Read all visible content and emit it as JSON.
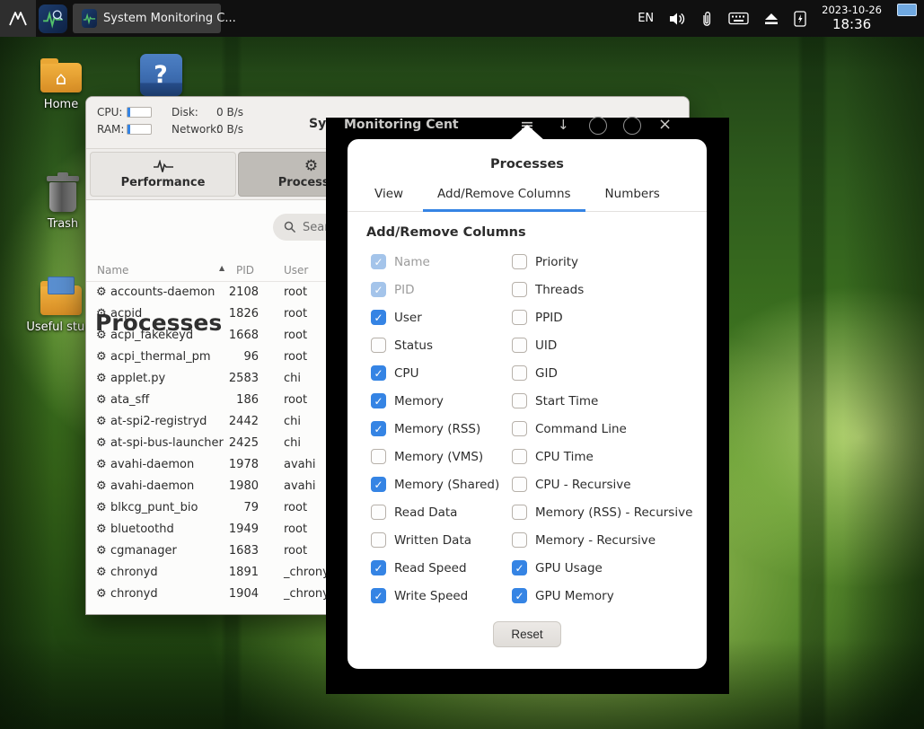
{
  "colors": {
    "accent": "#3584e4",
    "panel_bg": "#101010",
    "backdrop": "#000000",
    "check_disabled": "#a4c4ea"
  },
  "icons": {
    "gear": "⚙",
    "sort_asc": "▲",
    "hamburger": "≡",
    "down_arrow": "↓",
    "close": "×",
    "check": "✓",
    "house": "⌂",
    "question_mark": "?"
  },
  "panel": {
    "app_button": "System Monitoring C...",
    "language": "EN",
    "date": "2023-10-26",
    "time": "18:36"
  },
  "desktop": {
    "icons": [
      {
        "label": "Home"
      },
      {
        "label": "Trash"
      },
      {
        "label": "Useful stu..."
      }
    ]
  },
  "window": {
    "title_visible_left": "Syst",
    "title_visible_right": "Monitoring Cent",
    "stats": {
      "cpu_label": "CPU:",
      "ram_label": "RAM:",
      "disk_label": "Disk:",
      "disk_value": "0 B/s",
      "network_label": "Network:",
      "network_value": "0 B/s"
    },
    "tabs": [
      {
        "label": "Performance",
        "active": false
      },
      {
        "label": "Processes",
        "active": true
      }
    ],
    "page_title": "Processes",
    "search_placeholder": "Sear",
    "table": {
      "columns": [
        "Name",
        "PID",
        "User"
      ],
      "sort_column": "Name",
      "sort_direction": "ascending",
      "rows": [
        {
          "name": "accounts-daemon",
          "pid": "2108",
          "user": "root"
        },
        {
          "name": "acpid",
          "pid": "1826",
          "user": "root"
        },
        {
          "name": "acpi_fakekeyd",
          "pid": "1668",
          "user": "root"
        },
        {
          "name": "acpi_thermal_pm",
          "pid": "96",
          "user": "root"
        },
        {
          "name": "applet.py",
          "pid": "2583",
          "user": "chi"
        },
        {
          "name": "ata_sff",
          "pid": "186",
          "user": "root"
        },
        {
          "name": "at-spi2-registryd",
          "pid": "2442",
          "user": "chi"
        },
        {
          "name": "at-spi-bus-launcher",
          "pid": "2425",
          "user": "chi"
        },
        {
          "name": "avahi-daemon",
          "pid": "1978",
          "user": "avahi"
        },
        {
          "name": "avahi-daemon",
          "pid": "1980",
          "user": "avahi"
        },
        {
          "name": "blkcg_punt_bio",
          "pid": "79",
          "user": "root"
        },
        {
          "name": "bluetoothd",
          "pid": "1949",
          "user": "root"
        },
        {
          "name": "cgmanager",
          "pid": "1683",
          "user": "root"
        },
        {
          "name": "chronyd",
          "pid": "1891",
          "user": "_chrony"
        },
        {
          "name": "chronyd",
          "pid": "1904",
          "user": "_chrony"
        }
      ]
    }
  },
  "popover": {
    "title": "Processes",
    "tabs": [
      {
        "label": "View",
        "active": false
      },
      {
        "label": "Add/Remove Columns",
        "active": true
      },
      {
        "label": "Numbers",
        "active": false
      }
    ],
    "section_heading": "Add/Remove Columns",
    "columns": {
      "left": [
        {
          "label": "Name",
          "checked": true,
          "disabled": true
        },
        {
          "label": "PID",
          "checked": true,
          "disabled": true
        },
        {
          "label": "User",
          "checked": true,
          "disabled": false
        },
        {
          "label": "Status",
          "checked": false,
          "disabled": false
        },
        {
          "label": "CPU",
          "checked": true,
          "disabled": false
        },
        {
          "label": "Memory",
          "checked": true,
          "disabled": false
        },
        {
          "label": "Memory (RSS)",
          "checked": true,
          "disabled": false
        },
        {
          "label": "Memory (VMS)",
          "checked": false,
          "disabled": false
        },
        {
          "label": "Memory (Shared)",
          "checked": true,
          "disabled": false
        },
        {
          "label": "Read Data",
          "checked": false,
          "disabled": false
        },
        {
          "label": "Written Data",
          "checked": false,
          "disabled": false
        },
        {
          "label": "Read Speed",
          "checked": true,
          "disabled": false
        },
        {
          "label": "Write Speed",
          "checked": true,
          "disabled": false
        }
      ],
      "right": [
        {
          "label": "Priority",
          "checked": false,
          "disabled": false
        },
        {
          "label": "Threads",
          "checked": false,
          "disabled": false
        },
        {
          "label": "PPID",
          "checked": false,
          "disabled": false
        },
        {
          "label": "UID",
          "checked": false,
          "disabled": false
        },
        {
          "label": "GID",
          "checked": false,
          "disabled": false
        },
        {
          "label": "Start Time",
          "checked": false,
          "disabled": false
        },
        {
          "label": "Command Line",
          "checked": false,
          "disabled": false
        },
        {
          "label": "CPU Time",
          "checked": false,
          "disabled": false
        },
        {
          "label": "CPU - Recursive",
          "checked": false,
          "disabled": false
        },
        {
          "label": "Memory (RSS) - Recursive",
          "checked": false,
          "disabled": false
        },
        {
          "label": "Memory - Recursive",
          "checked": false,
          "disabled": false
        },
        {
          "label": "GPU Usage",
          "checked": true,
          "disabled": false
        },
        {
          "label": "GPU Memory",
          "checked": true,
          "disabled": false
        }
      ]
    },
    "reset_label": "Reset"
  }
}
